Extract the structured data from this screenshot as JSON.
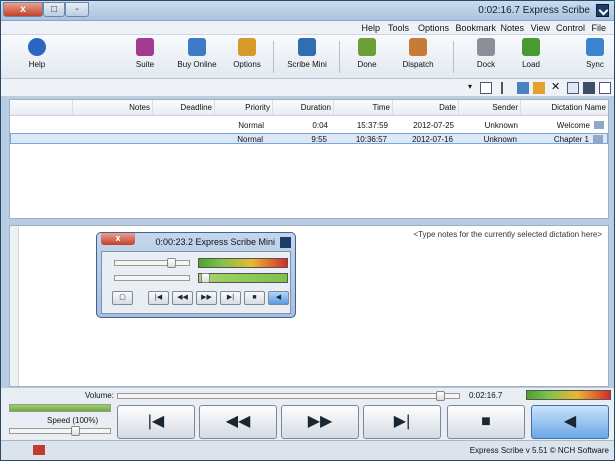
{
  "window": {
    "title": "0:02:16.7 Express Scribe"
  },
  "titlebar": {
    "close": "x",
    "max": "□",
    "min": "-"
  },
  "menu": [
    "File",
    "Control",
    "View",
    "Notes",
    "Bookmark",
    "Options",
    "Tools",
    "Help"
  ],
  "toolbar": [
    {
      "label": "Sync",
      "icon": "sync-icon",
      "color": "#3b84d0"
    },
    {
      "label": "Load",
      "icon": "load-icon",
      "color": "#4a9b2f"
    },
    {
      "label": "Dock",
      "icon": "dock-icon",
      "color": "#8a8f99"
    },
    {
      "label": "Dispatch",
      "icon": "dispatch-icon",
      "color": "#c67b36"
    },
    {
      "label": "Done",
      "icon": "done-icon",
      "color": "#6aa037"
    },
    {
      "label": "Scribe Mini",
      "icon": "scribe-mini-icon",
      "color": "#2f6db5"
    },
    {
      "label": "Options",
      "icon": "options-icon",
      "color": "#d69a2b"
    },
    {
      "label": "Buy Online",
      "icon": "buy-online-icon",
      "color": "#3d7ac7"
    },
    {
      "label": "Suite",
      "icon": "suite-icon",
      "color": "#a33b8f"
    },
    {
      "label": "Help",
      "icon": "help-icon",
      "color": "#2b66c0"
    }
  ],
  "list": {
    "columns": [
      "Dictation Name",
      "Sender",
      "Date",
      "Time",
      "Duration",
      "Priority",
      "Deadline",
      "Notes"
    ],
    "rows": [
      {
        "name": "Welcome",
        "sender": "Unknown",
        "date": "2012-07-25",
        "time": "15:37:59",
        "duration": "0:04",
        "priority": "Normal"
      },
      {
        "name": "Chapter 1",
        "sender": "Unknown",
        "date": "2012-07-16",
        "time": "10:36:57",
        "duration": "9:55",
        "priority": "Normal"
      }
    ]
  },
  "notes": {
    "placeholder": "<Type notes for the currently selected dictation here>"
  },
  "mini": {
    "title": "0:00:23.2 Express Scribe Mini",
    "close": "x"
  },
  "bottom": {
    "time": "0:02:16.7",
    "volume": "Volume:",
    "speed": "Speed (100%)"
  },
  "status": {
    "text": "Express Scribe v 5.51 © NCH Software"
  }
}
